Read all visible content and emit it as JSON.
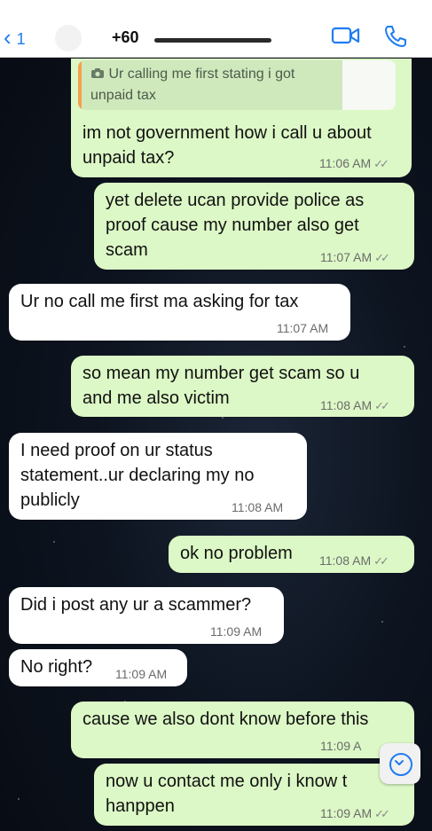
{
  "header": {
    "back_count": "1",
    "contact_name": "+60"
  },
  "messages": [
    {
      "text": "im not government how i call u about\nunpaid tax?",
      "time": "11:06 AM",
      "quote": "Ur calling me first stating i got\nunpaid tax"
    },
    {
      "text": "yet delete ucan provide police as\nproof cause my number also get\nscam",
      "time": "11:07 AM"
    },
    {
      "text": "Ur no call me first ma asking for tax",
      "time": "11:07 AM"
    },
    {
      "text": "so mean my number get scam so u\nand me also victim",
      "time": "11:08 AM"
    },
    {
      "text": "I need proof on ur status\nstatement..ur declaring my no\npublicly",
      "time": "11:08 AM"
    },
    {
      "text": "ok no problem",
      "time": "11:08 AM"
    },
    {
      "text": "Did i post any ur a scammer?",
      "time": "11:09 AM"
    },
    {
      "text": "No right?",
      "time": "11:09 AM"
    },
    {
      "text": "cause we also dont know before this",
      "time": "11:09 A"
    },
    {
      "text": "now u contact me only i know t\nhanppen",
      "time": "11:09 AM"
    }
  ],
  "colors": {
    "outgoing": "#dcf8c6",
    "incoming": "#ffffff",
    "accent": "#1e7cf2"
  }
}
